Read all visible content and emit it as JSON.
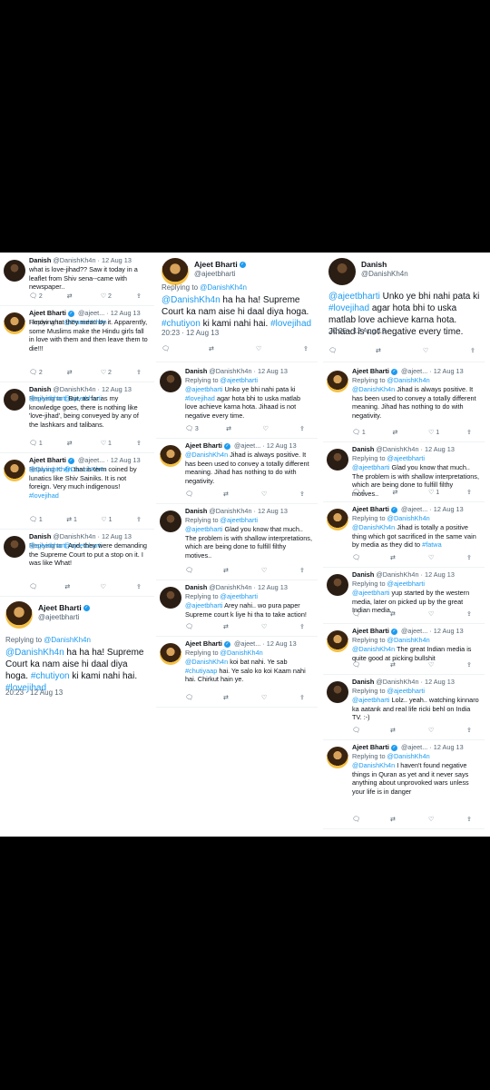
{
  "icons": {
    "reply": "reply-icon",
    "retweet": "retweet-icon",
    "like": "like-icon",
    "share": "share-icon",
    "verified": "verified-badge-icon"
  },
  "colors": {
    "link": "#1d9bf0",
    "muted": "#536471",
    "text": "#0f1419",
    "background": "#000000"
  },
  "col1": {
    "tweets": [
      {
        "name": "Danish",
        "handle": "@DanishKh4n · 12 Aug 13",
        "verified": false,
        "replying": "",
        "text": "what is love-jihad?? Saw it today in a leaflet from Shiv sena--came with newspaper..",
        "counts": {
          "reply": "2",
          "retweet": "",
          "like": "2"
        }
      },
      {
        "name": "Ajeet Bharti",
        "handle": "@ajeet... · 12 Aug 13",
        "verified": true,
        "replying": "Replying to @DanishKh4n",
        "text": "I know what they mean by it. Apparently, some Muslims make the Hindu girls fall in love with them and then leave them to die!!!",
        "counts": {
          "reply": "2",
          "retweet": "",
          "like": "2"
        }
      },
      {
        "name": "Danish",
        "handle": "@DanishKh4n · 12 Aug 13",
        "verified": false,
        "replying": "Replying to @ajeetbharti",
        "text": "@ajeetbharti But, as far as my knowledge goes, there is nothing like 'love-jihad', being conveyed by any of the lashkars and talibans.",
        "counts": {
          "reply": "1",
          "retweet": "",
          "like": "1"
        }
      },
      {
        "name": "Ajeet Bharti",
        "handle": "@ajeet... · 12 Aug 13",
        "verified": true,
        "replying": "Replying to @DanishKh4n",
        "text": "@DanishKh4n that is term coined by lunatics like Shiv Sainiks. It is not foreign. Very much indigenous! #lovejihad",
        "counts": {
          "reply": "1",
          "retweet": "1",
          "like": "1"
        }
      },
      {
        "name": "Danish",
        "handle": "@DanishKh4n · 12 Aug 13",
        "verified": false,
        "replying": "Replying to @ajeetbharti",
        "text": "@ajeetbharti And, they were demanding the Supreme Court to put a stop on it. I was like What!",
        "counts": {
          "reply": "",
          "retweet": "",
          "like": ""
        }
      }
    ],
    "main": {
      "name": "Ajeet Bharti",
      "handle": "@ajeetbharti",
      "replying_label": "Replying to",
      "replying_to": "@DanishKh4n",
      "mention": "@DanishKh4n",
      "text": " ha ha ha! Supreme Court ka nam aise hi daal diya hoga. ",
      "tag1": "#chutiyon",
      "text2": " ki kami nahi hai. ",
      "tag2": "#lovejihad",
      "time": "20:23 · 12 Aug 13"
    }
  },
  "col2": {
    "main": {
      "name": "Ajeet Bharti",
      "handle": "@ajeetbharti",
      "replying_label": "Replying to",
      "replying_to": "@DanishKh4n",
      "mention": "@DanishKh4n",
      "text": " ha ha ha! Supreme Court ka nam aise hi daal diya hoga. ",
      "tag1": "#chutiyon",
      "text2": " ki kami nahi hai. ",
      "tag2": "#lovejihad",
      "time": "20:23 · 12 Aug 13"
    },
    "tweets": [
      {
        "name": "Danish",
        "handle": "@DanishKh4n · 12 Aug 13",
        "verified": false,
        "replying": "Replying to @ajeetbharti",
        "text": "@ajeetbharti Unko ye bhi nahi pata ki #lovejihad agar hota bhi to uska matlab love achieve karna hota. Jihaad is not negative every time.",
        "counts": {
          "reply": "3",
          "retweet": "",
          "like": ""
        }
      },
      {
        "name": "Ajeet Bharti",
        "handle": "@ajeet... · 12 Aug 13",
        "verified": true,
        "replying": "",
        "text": "@DanishKh4n Jihad is always positive. It has been used to convey a totally different meaning. Jihad has nothing to do with negativity.",
        "counts": {
          "reply": "",
          "retweet": "",
          "like": ""
        }
      },
      {
        "name": "Danish",
        "handle": "@DanishKh4n · 12 Aug 13",
        "verified": false,
        "replying": "Replying to @ajeetbharti",
        "text": "@ajeetbharti Glad you know that much.. The problem is with shallow interpretations, which are being done to fulfill filthy motives..",
        "counts": {
          "reply": "",
          "retweet": "",
          "like": ""
        }
      },
      {
        "name": "Danish",
        "handle": "@DanishKh4n · 12 Aug 13",
        "verified": false,
        "replying": "Replying to @ajeetbharti",
        "text": "@ajeetbharti Arey nahi.. wo pura paper Supreme court k liye hi tha to take action!",
        "counts": {
          "reply": "",
          "retweet": "",
          "like": ""
        }
      },
      {
        "name": "Ajeet Bharti",
        "handle": "@ajeet... · 12 Aug 13",
        "verified": true,
        "replying": "Replying to @DanishKh4n",
        "text": "@DanishKh4n koi bat nahi. Ye sab #chutiyaap hai. Ye salo ko koi Kaam nahi hai. Chirkut hain ye.",
        "counts": {
          "reply": "",
          "retweet": "",
          "like": ""
        }
      }
    ]
  },
  "col3": {
    "main": {
      "name": "Danish",
      "handle": "@DanishKh4n",
      "mention": "@ajeetbharti",
      "text": " Unko ye bhi nahi pata ki ",
      "tag1": "#lovejihad",
      "text2": " agar hota bhi to uska matlab love achieve karna hota. Jihaad is not negative every time.",
      "time": "20:25 · 12 Aug 13"
    },
    "tweets": [
      {
        "name": "Ajeet Bharti",
        "handle": "@ajeet... · 12 Aug 13",
        "verified": true,
        "replying": "Replying to @DanishKh4n",
        "text": "@DanishKh4n Jihad is always positive. It has been used to convey a totally different meaning. Jihad has nothing to do with negativity.",
        "counts": {
          "reply": "1",
          "retweet": "",
          "like": "1"
        }
      },
      {
        "name": "Danish",
        "handle": "@DanishKh4n · 12 Aug 13",
        "verified": false,
        "replying": "Replying to @ajeetbharti",
        "text": "@ajeetbharti Glad you know that much.. The problem is with shallow interpretations, which are being done to fulfill filthy motives..",
        "counts": {
          "reply": "1",
          "retweet": "",
          "like": "1"
        }
      },
      {
        "name": "Ajeet Bharti",
        "handle": "@ajeet... · 12 Aug 13",
        "verified": true,
        "replying": "Replying to @DanishKh4n",
        "text": "@DanishKh4n Jihad is totally a positive thing which got sacrificed in the same vain by media as they did to #fatwa",
        "counts": {
          "reply": "",
          "retweet": "",
          "like": ""
        }
      },
      {
        "name": "Danish",
        "handle": "@DanishKh4n · 12 Aug 13",
        "verified": false,
        "replying": "Replying to @ajeetbharti",
        "text": "@ajeetbharti yup started by the western media, later on picked up by the great Indian media..",
        "counts": {
          "reply": "",
          "retweet": "",
          "like": ""
        }
      },
      {
        "name": "Ajeet Bharti",
        "handle": "@ajeet... · 12 Aug 13",
        "verified": true,
        "replying": "Replying to @DanishKh4n",
        "text": "@DanishKh4n The great Indian media is quite good at picking bullshit",
        "counts": {
          "reply": "",
          "retweet": "",
          "like": ""
        }
      },
      {
        "name": "Danish",
        "handle": "@DanishKh4n · 12 Aug 13",
        "verified": false,
        "replying": "Replying to @ajeetbharti",
        "text": "@ajeetbharti Lolz.. yeah.. watching kinnaro ka aatank and real life ricki behl on India TV. :-)",
        "counts": {
          "reply": "",
          "retweet": "",
          "like": ""
        }
      },
      {
        "name": "Ajeet Bharti",
        "handle": "@ajeet... · 12 Aug 13",
        "verified": true,
        "replying": "Replying to @DanishKh4n",
        "text": "@DanishKh4n I haven't found negative things in Quran as yet and it never says anything about unprovoked wars unless your life is in danger",
        "counts": {
          "reply": "",
          "retweet": "",
          "like": ""
        }
      }
    ]
  }
}
